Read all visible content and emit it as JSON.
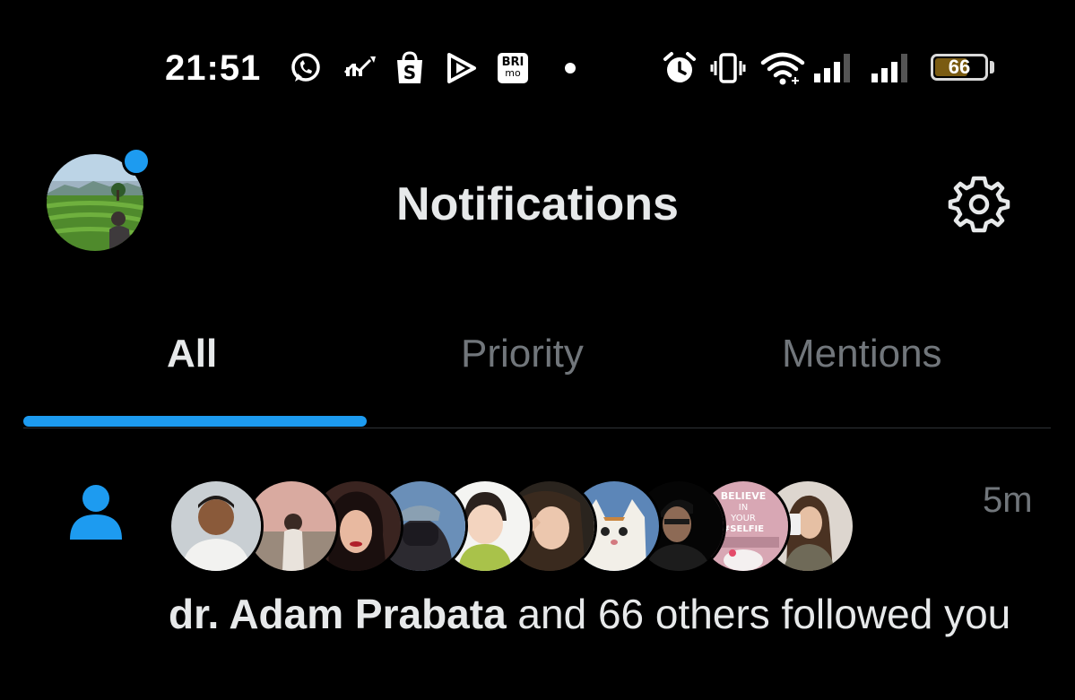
{
  "status_bar": {
    "time": "21:51",
    "battery_level": "66",
    "battery_fraction": 0.66,
    "left_icons": [
      "whatsapp-icon",
      "stock-chart-icon",
      "shopee-bag-icon",
      "play-icon",
      "brimo-icon",
      "dot-icon"
    ],
    "brimo_label_top": "BRI",
    "brimo_label_bottom": "mo",
    "right_icons": [
      "alarm-icon",
      "vibrate-icon",
      "wifi-icon",
      "signal-icon",
      "signal-icon",
      "battery-icon"
    ]
  },
  "header": {
    "title": "Notifications",
    "settings_icon": "gear-icon",
    "has_unread_dot": true
  },
  "tabs": [
    {
      "label": "All",
      "active": true
    },
    {
      "label": "Priority",
      "active": false
    },
    {
      "label": "Mentions",
      "active": false
    }
  ],
  "notification": {
    "icon": "person-icon",
    "timestamp": "5m",
    "actor": "dr. Adam Prabata",
    "message": " and 66 others followed you",
    "follower_avatar_count": 10,
    "selfie_sign_text": "BELIEVE IN YOUR #SELFIE"
  },
  "colors": {
    "background": "#000000",
    "accent": "#1d9bf0",
    "text_primary": "#e7e9ea",
    "text_secondary": "#71767b",
    "divider": "#2f3336"
  }
}
